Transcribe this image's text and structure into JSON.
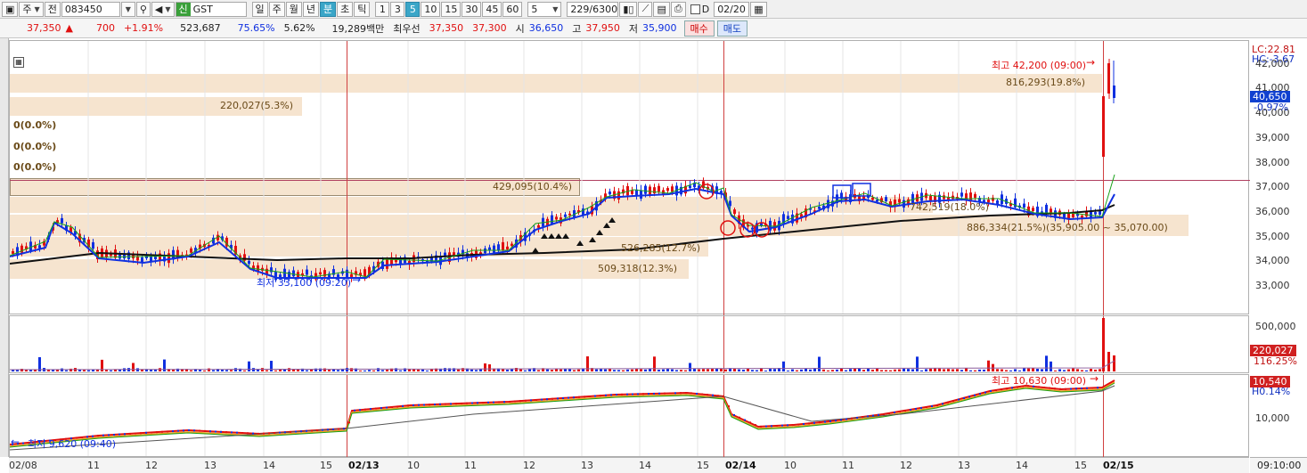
{
  "toolbar": {
    "code": "083450",
    "name_badge": "신",
    "name": "GST",
    "chart_mode_jeon": "전",
    "chart_mode_ju": "주",
    "periods": [
      "일",
      "주",
      "월",
      "년",
      "분",
      "초",
      "틱"
    ],
    "active_period": "분",
    "intervals": [
      "1",
      "3",
      "5",
      "10",
      "15",
      "30",
      "45",
      "60"
    ],
    "active_interval": "5",
    "interval_value": "5",
    "count": "229/6300",
    "d_label": "D",
    "date": "02/20"
  },
  "quote": {
    "price": "37,350",
    "change": "700",
    "change_pct": "+1.91%",
    "volume": "523,687",
    "vol_ratio": "75.65%",
    "turnover": "5.62%",
    "amount": "19,289백만",
    "best_label": "최우선",
    "ask": "37,350",
    "bid": "37,300",
    "open_label": "시",
    "open": "36,650",
    "high_label": "고",
    "high": "37,950",
    "low_label": "저",
    "low": "35,900",
    "buy_label": "매수",
    "sell_label": "매도"
  },
  "price_axis": {
    "labels": [
      "42,000",
      "41,000",
      "40,000",
      "39,000",
      "38,000",
      "37,000",
      "36,000",
      "35,000",
      "34,000",
      "33,000"
    ],
    "lc": "LC:22.81",
    "hc": "HC:-3.67",
    "current": "40,650",
    "current_pct": "-0.97%"
  },
  "volume_axis": {
    "labels": [
      "500,000"
    ],
    "current": "220,027",
    "current_pct": "116.25%"
  },
  "indicator_axis": {
    "labels": [
      "10,000"
    ],
    "current": "10,540",
    "current_pct": "H0.14%"
  },
  "x_axis": {
    "labels": [
      "02/08",
      "11",
      "12",
      "13",
      "14",
      "15",
      "02/13",
      "10",
      "11",
      "12",
      "13",
      "14",
      "15",
      "02/14",
      "10",
      "11",
      "12",
      "13",
      "14",
      "15",
      "02/15"
    ],
    "time": "09:10:00"
  },
  "annotations": {
    "high_price": "최고 42,200 (09:00)",
    "low_price": "최저 33,100 (09:20)",
    "ind_high": "최고 10,630 (09:00)",
    "ind_low": "최저 9,620 (09:40)",
    "vp": [
      "816,293(19.8%)",
      "220,027(5.3%)",
      "0(0.0%)",
      "0(0.0%)",
      "0(0.0%)",
      "429,095(10.4%)",
      "742,519(18.0%)",
      "886,334(21.5%)(35,905.00 ~ 35,070.00)",
      "526,285(12.7%)",
      "509,318(12.3%)"
    ]
  },
  "colors": {
    "up": "#e01010",
    "down": "#1030e0",
    "ma_long": "#111111",
    "ma_mid": "#1030e0",
    "ma_short": "#18a018",
    "band": "#f6e4cf"
  }
}
